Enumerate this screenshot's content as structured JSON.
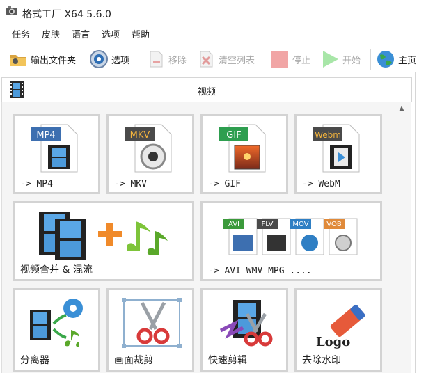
{
  "window": {
    "title": "格式工厂 X64 5.6.0"
  },
  "menu": [
    "任务",
    "皮肤",
    "语言",
    "选项",
    "帮助"
  ],
  "toolbar": {
    "output_folder": "输出文件夹",
    "options": "选项",
    "remove": "移除",
    "clear_list": "清空列表",
    "stop": "停止",
    "start": "开始",
    "home": "主页"
  },
  "section": {
    "title": "视频"
  },
  "tiles": {
    "mp4": {
      "label": "-> MP4",
      "badge": "MP4"
    },
    "mkv": {
      "label": "-> MKV",
      "badge": "MKV"
    },
    "gif": {
      "label": "-> GIF",
      "badge": "GIF"
    },
    "webm": {
      "label": "-> WebM",
      "badge": "Webm"
    },
    "merge": {
      "label": "视频合并 & 混流"
    },
    "other": {
      "label": "-> AVI WMV MPG ....",
      "badges": [
        "AVI",
        "FLV",
        "MOV",
        "VOB"
      ]
    },
    "splitter": {
      "label": "分离器"
    },
    "crop": {
      "label": "画面裁剪"
    },
    "fastcut": {
      "label": "快速剪辑"
    },
    "watermark": {
      "label": "去除水印",
      "logo_text": "Logo"
    }
  },
  "colors": {
    "mp4_badge": "#3d6fb0",
    "mkv_badge": "#4a4a4a",
    "gif_badge": "#2e9e4f",
    "webm_badge": "#4a4a4a",
    "avi": "#3b9a3b",
    "flv": "#4a4a4a",
    "mov": "#2f7fc4",
    "vob": "#e08a3a"
  }
}
